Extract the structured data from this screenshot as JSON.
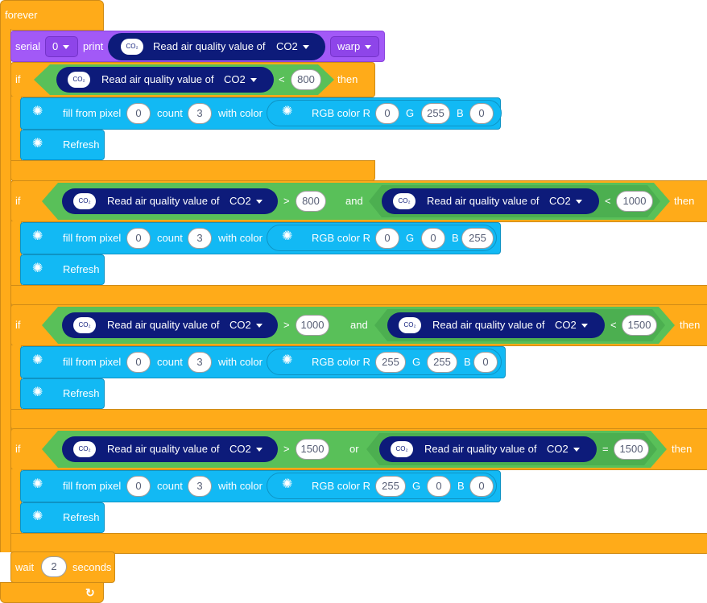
{
  "forever_label": "forever",
  "serial": {
    "label": "serial",
    "port": "0",
    "print_label": "print",
    "reporter_text": "Read air quality value of",
    "gas": "CO2",
    "mode": "warp"
  },
  "icons": {
    "co2": "co2-cloud-icon",
    "led": "led-light-icon",
    "loop": "loop-arrow-icon"
  },
  "if_label": "if",
  "then_label": "then",
  "fill": {
    "prefix": "fill from pixel",
    "count_label": "count",
    "with_color": "with color",
    "rgb_label": "RGB color R",
    "g_label": "G",
    "b_label": "B"
  },
  "refresh_label": "Refresh",
  "read_label": "Read air quality value of",
  "blocks": [
    {
      "op1": "<",
      "val1": "800",
      "logic": "",
      "op2": "",
      "val2": "",
      "pixel": "0",
      "count": "3",
      "r": "0",
      "g": "255",
      "b": "0"
    },
    {
      "op1": ">",
      "val1": "800",
      "logic": "and",
      "op2": "<",
      "val2": "1000",
      "pixel": "0",
      "count": "3",
      "r": "0",
      "g": "0",
      "b": "255"
    },
    {
      "op1": ">",
      "val1": "1000",
      "logic": "and",
      "op2": "<",
      "val2": "1500",
      "pixel": "0",
      "count": "3",
      "r": "255",
      "g": "255",
      "b": "0"
    },
    {
      "op1": ">",
      "val1": "1500",
      "logic": "or",
      "op2": "=",
      "val2": "1500",
      "pixel": "0",
      "count": "3",
      "r": "255",
      "g": "0",
      "b": "0"
    }
  ],
  "wait": {
    "label": "wait",
    "value": "2",
    "unit": "seconds"
  },
  "colors": {
    "control": "#FFAB19",
    "looks": "#A259F7",
    "light": "#12B9F4",
    "operator": "#59C059",
    "sensor": "#0D1B7A"
  }
}
